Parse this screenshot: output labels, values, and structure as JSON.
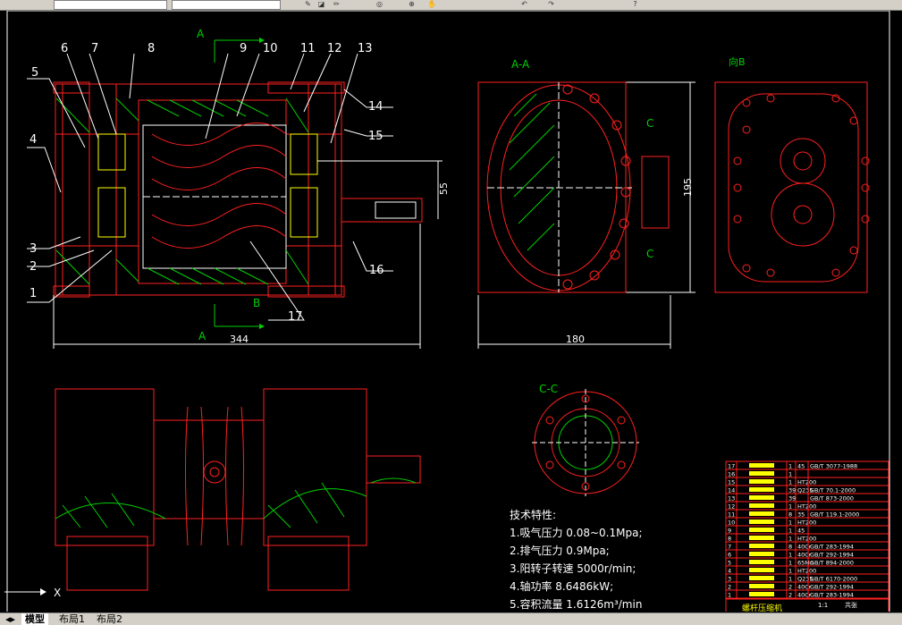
{
  "toolbar": {
    "buttons": [
      "open-icon",
      "layer-icon",
      "draw-icon",
      "snap-icon",
      "zoom-icon",
      "pan-icon",
      "undo-icon",
      "redo-icon",
      "help-icon"
    ]
  },
  "sections": {
    "aa": "A-A",
    "aa_top": "A",
    "aa_bottom": "A",
    "b": "B",
    "b_view": "向B",
    "cc": "C-C",
    "c": "C"
  },
  "leaders": [
    "1",
    "2",
    "3",
    "4",
    "5",
    "6",
    "7",
    "8",
    "9",
    "10",
    "11",
    "12",
    "13",
    "14",
    "15",
    "16",
    "17"
  ],
  "dims": {
    "d344": "344",
    "d55": "55",
    "d180": "180",
    "d195": "195"
  },
  "tech": {
    "title": "技术特性:",
    "l1": "1.吸气压力 0.08~0.1Mpa;",
    "l2": "2.排气压力 0.9Mpa;",
    "l3": "3.阳转子转速 5000r/min;",
    "l4": "4.轴功率 8.6486kW;",
    "l5": "5.容积流量 1.6126m³/min"
  },
  "title_block": {
    "name": "螺杆压缩机",
    "scale": "1:1",
    "sheet": "共张"
  },
  "bom": [
    {
      "n": "17",
      "q": "1",
      "m": "45",
      "s": "GB/T 3077-1988"
    },
    {
      "n": "16",
      "q": "1",
      "m": "",
      "s": ""
    },
    {
      "n": "15",
      "q": "1",
      "m": "HT200",
      "s": ""
    },
    {
      "n": "14",
      "q": "39",
      "m": "Q235",
      "s": "GB/T 70.1-2000"
    },
    {
      "n": "13",
      "q": "39",
      "m": "",
      "s": "GB/T 873-2000"
    },
    {
      "n": "12",
      "q": "1",
      "m": "HT200",
      "s": ""
    },
    {
      "n": "11",
      "q": "8",
      "m": "35",
      "s": "GB/T 119.1-2000"
    },
    {
      "n": "10",
      "q": "1",
      "m": "HT200",
      "s": ""
    },
    {
      "n": "9",
      "q": "1",
      "m": "45",
      "s": ""
    },
    {
      "n": "8",
      "q": "1",
      "m": "HT200",
      "s": ""
    },
    {
      "n": "7",
      "q": "8",
      "m": "40Cr",
      "s": "GB/T 283-1994"
    },
    {
      "n": "6",
      "q": "1",
      "m": "40Cr",
      "s": "GB/T 292-1994"
    },
    {
      "n": "5",
      "q": "1",
      "m": "65Mn",
      "s": "GB/T 894-2000"
    },
    {
      "n": "4",
      "q": "1",
      "m": "HT200",
      "s": ""
    },
    {
      "n": "3",
      "q": "1",
      "m": "Q235",
      "s": "GB/T 6170-2000"
    },
    {
      "n": "2",
      "q": "2",
      "m": "40Cr",
      "s": "GB/T 292-1994"
    },
    {
      "n": "1",
      "q": "2",
      "m": "40Cr",
      "s": "GB/T 283-1994"
    }
  ],
  "axis_label": "X",
  "tabs": [
    "模型",
    "布局1",
    "布局2"
  ],
  "colors": {
    "red": "#ff2020",
    "green": "#00d000",
    "yellow": "#ffff00",
    "white": "#ffffff",
    "bg": "#000000"
  }
}
